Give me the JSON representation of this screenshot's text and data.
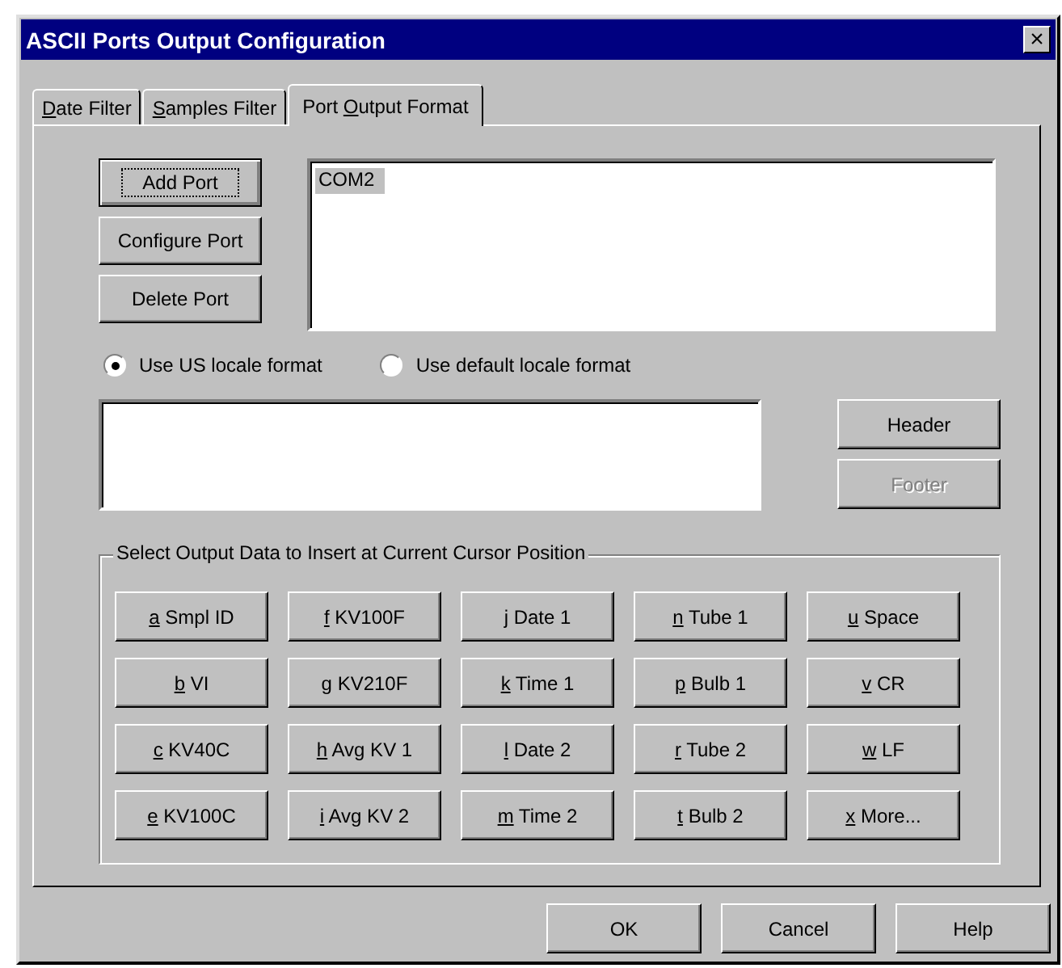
{
  "window": {
    "title": "ASCII Ports Output Configuration",
    "close": "×"
  },
  "tabs": [
    {
      "key": "D",
      "rest": "ate Filter",
      "selected": false
    },
    {
      "key": "S",
      "rest": "amples Filter",
      "selected": false
    },
    {
      "lead": "Port ",
      "key": "O",
      "rest": "utput Format",
      "selected": true
    }
  ],
  "port_buttons": [
    {
      "label": "Add Port",
      "focused": true
    },
    {
      "label": "Configure Port",
      "focused": false
    },
    {
      "label": "Delete Port",
      "focused": false
    }
  ],
  "ports": [
    {
      "name": "COM2",
      "selected": true
    }
  ],
  "locale_options": [
    {
      "label": "Use US locale format",
      "selected": true
    },
    {
      "label": "Use default locale format",
      "selected": false
    }
  ],
  "format_buttons": [
    {
      "label": "Header",
      "disabled": false
    },
    {
      "label": "Footer",
      "disabled": true
    }
  ],
  "insert_group": {
    "title": "Select Output Data to Insert at Current Cursor Position",
    "buttons": [
      "a Smpl ID",
      "f KV100F",
      "j Date 1",
      "n Tube 1",
      "u Space",
      "b VI",
      "g KV210F",
      "k Time 1",
      "p Bulb 1",
      "v CR",
      "c KV40C",
      "h Avg KV 1",
      "l Date 2",
      "r Tube 2",
      "w LF",
      "e KV100C",
      "i Avg KV 2",
      "m Time 2",
      "t Bulb 2",
      "x More..."
    ]
  },
  "dialog_buttons": [
    "OK",
    "Cancel",
    "Help"
  ]
}
